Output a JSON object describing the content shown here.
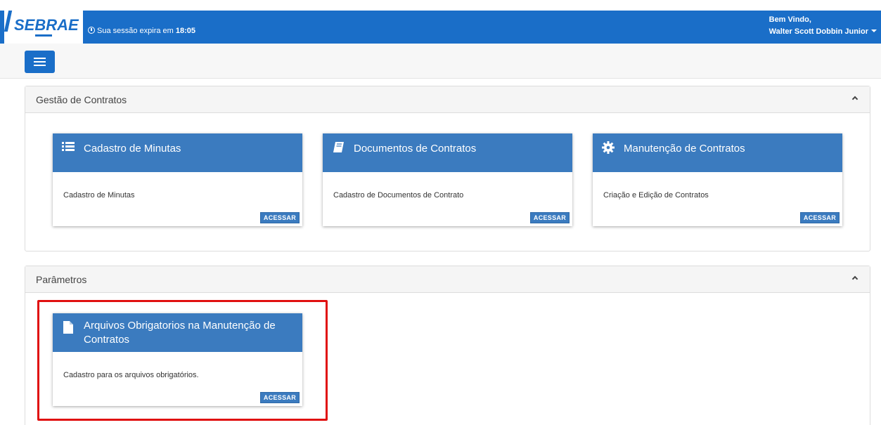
{
  "header": {
    "logo_text": "SEBRAE",
    "session_prefix": "Sua sessão expira em",
    "session_time": "18:05",
    "welcome": "Bem Vindo,",
    "user_name": "Walter Scott Dobbin Junior"
  },
  "colors": {
    "primary": "#1a6ec8",
    "card_header": "#3b7bbf",
    "highlight": "#e01010"
  },
  "sections": [
    {
      "title": "Gestão de Contratos",
      "cards": [
        {
          "icon": "list-icon",
          "title": "Cadastro de Minutas",
          "description": "Cadastro de Minutas",
          "button": "ACESSAR"
        },
        {
          "icon": "book-icon",
          "title": "Documentos de Contratos",
          "description": "Cadastro de Documentos de Contrato",
          "button": "ACESSAR"
        },
        {
          "icon": "gear-icon",
          "title": "Manutenção de Contratos",
          "description": "Criação e Edição de Contratos",
          "button": "ACESSAR"
        }
      ]
    },
    {
      "title": "Parâmetros",
      "cards": [
        {
          "icon": "file-icon",
          "title": "Arquivos Obrigatorios na Manutenção de Contratos",
          "description": "Cadastro para os arquivos obrigatórios.",
          "button": "ACESSAR"
        }
      ]
    }
  ]
}
